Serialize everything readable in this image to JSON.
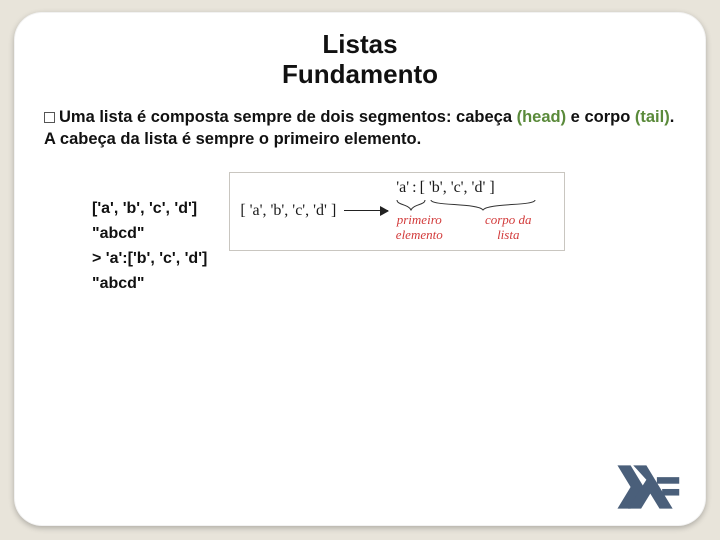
{
  "title_line1": "Listas",
  "title_line2": "Fundamento",
  "para": {
    "lead": "Uma",
    "t1": " lista é composta sempre de dois segmentos: cabeça ",
    "head": "(head)",
    "t2": " e corpo ",
    "tail": "(tail)",
    "t3": ". A cabeça da lista é sempre o primeiro elemento."
  },
  "code": [
    "['a', 'b', 'c', 'd']",
    "\"abcd\"",
    "> 'a':['b', 'c', 'd']",
    "\"abcd\""
  ],
  "diagram": {
    "lhs": "[ 'a', 'b', 'c', 'd' ]",
    "head": "'a'",
    "colon": ":",
    "rest": "[ 'b', 'c', 'd' ]",
    "label_primeiro": "primeiro",
    "label_elemento": "elemento",
    "label_corpo": "corpo da",
    "label_lista": "lista"
  },
  "colors": {
    "green": "#5a8a3a",
    "red": "#d23a3a",
    "logo": "#4a5f7a"
  }
}
